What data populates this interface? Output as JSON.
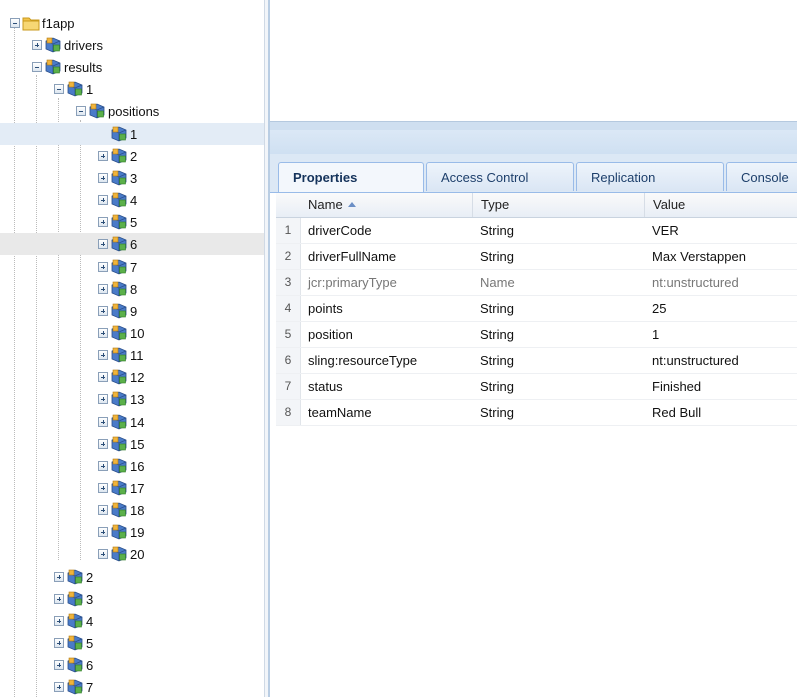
{
  "tree": {
    "root": {
      "label": "f1app",
      "icon": "folder-icon"
    },
    "nodes": [
      {
        "label": "drivers",
        "toggle": "plus"
      },
      {
        "label": "results",
        "toggle": "minus"
      },
      {
        "label": "1",
        "toggle": "minus"
      },
      {
        "label": "positions",
        "toggle": "minus"
      },
      {
        "label": "1",
        "toggle": "none",
        "selected": true
      },
      {
        "label": "2",
        "toggle": "plus"
      },
      {
        "label": "3",
        "toggle": "plus"
      },
      {
        "label": "4",
        "toggle": "plus"
      },
      {
        "label": "5",
        "toggle": "plus"
      },
      {
        "label": "6",
        "toggle": "plus",
        "hover": true
      },
      {
        "label": "7",
        "toggle": "plus"
      },
      {
        "label": "8",
        "toggle": "plus"
      },
      {
        "label": "9",
        "toggle": "plus"
      },
      {
        "label": "10",
        "toggle": "plus"
      },
      {
        "label": "11",
        "toggle": "plus"
      },
      {
        "label": "12",
        "toggle": "plus"
      },
      {
        "label": "13",
        "toggle": "plus"
      },
      {
        "label": "14",
        "toggle": "plus"
      },
      {
        "label": "15",
        "toggle": "plus"
      },
      {
        "label": "16",
        "toggle": "plus"
      },
      {
        "label": "17",
        "toggle": "plus"
      },
      {
        "label": "18",
        "toggle": "plus"
      },
      {
        "label": "19",
        "toggle": "plus"
      },
      {
        "label": "20",
        "toggle": "plus"
      },
      {
        "label": "2",
        "toggle": "plus"
      },
      {
        "label": "3",
        "toggle": "plus"
      },
      {
        "label": "4",
        "toggle": "plus"
      },
      {
        "label": "5",
        "toggle": "plus"
      },
      {
        "label": "6",
        "toggle": "plus"
      },
      {
        "label": "7",
        "toggle": "plus"
      }
    ]
  },
  "tabs": [
    {
      "label": "Properties",
      "active": true
    },
    {
      "label": "Access Control",
      "active": false
    },
    {
      "label": "Replication",
      "active": false
    },
    {
      "label": "Console",
      "active": false
    }
  ],
  "grid": {
    "columns": [
      "Name",
      "Type",
      "Value"
    ],
    "sorted_column": "Name",
    "rows": [
      {
        "num": "1",
        "name": "driverCode",
        "type": "String",
        "value": "VER",
        "greyed": false
      },
      {
        "num": "2",
        "name": "driverFullName",
        "type": "String",
        "value": "Max Verstappen",
        "greyed": false
      },
      {
        "num": "3",
        "name": "jcr:primaryType",
        "type": "Name",
        "value": "nt:unstructured",
        "greyed": true
      },
      {
        "num": "4",
        "name": "points",
        "type": "String",
        "value": "25",
        "greyed": false
      },
      {
        "num": "5",
        "name": "position",
        "type": "String",
        "value": "1",
        "greyed": false
      },
      {
        "num": "6",
        "name": "sling:resourceType",
        "type": "String",
        "value": "nt:unstructured",
        "greyed": false
      },
      {
        "num": "7",
        "name": "status",
        "type": "String",
        "value": "Finished",
        "greyed": false
      },
      {
        "num": "8",
        "name": "teamName",
        "type": "String",
        "value": "Red Bull",
        "greyed": false
      }
    ]
  },
  "colors": {
    "accent": "#99bbe8",
    "selected": "#e3ecf6"
  }
}
